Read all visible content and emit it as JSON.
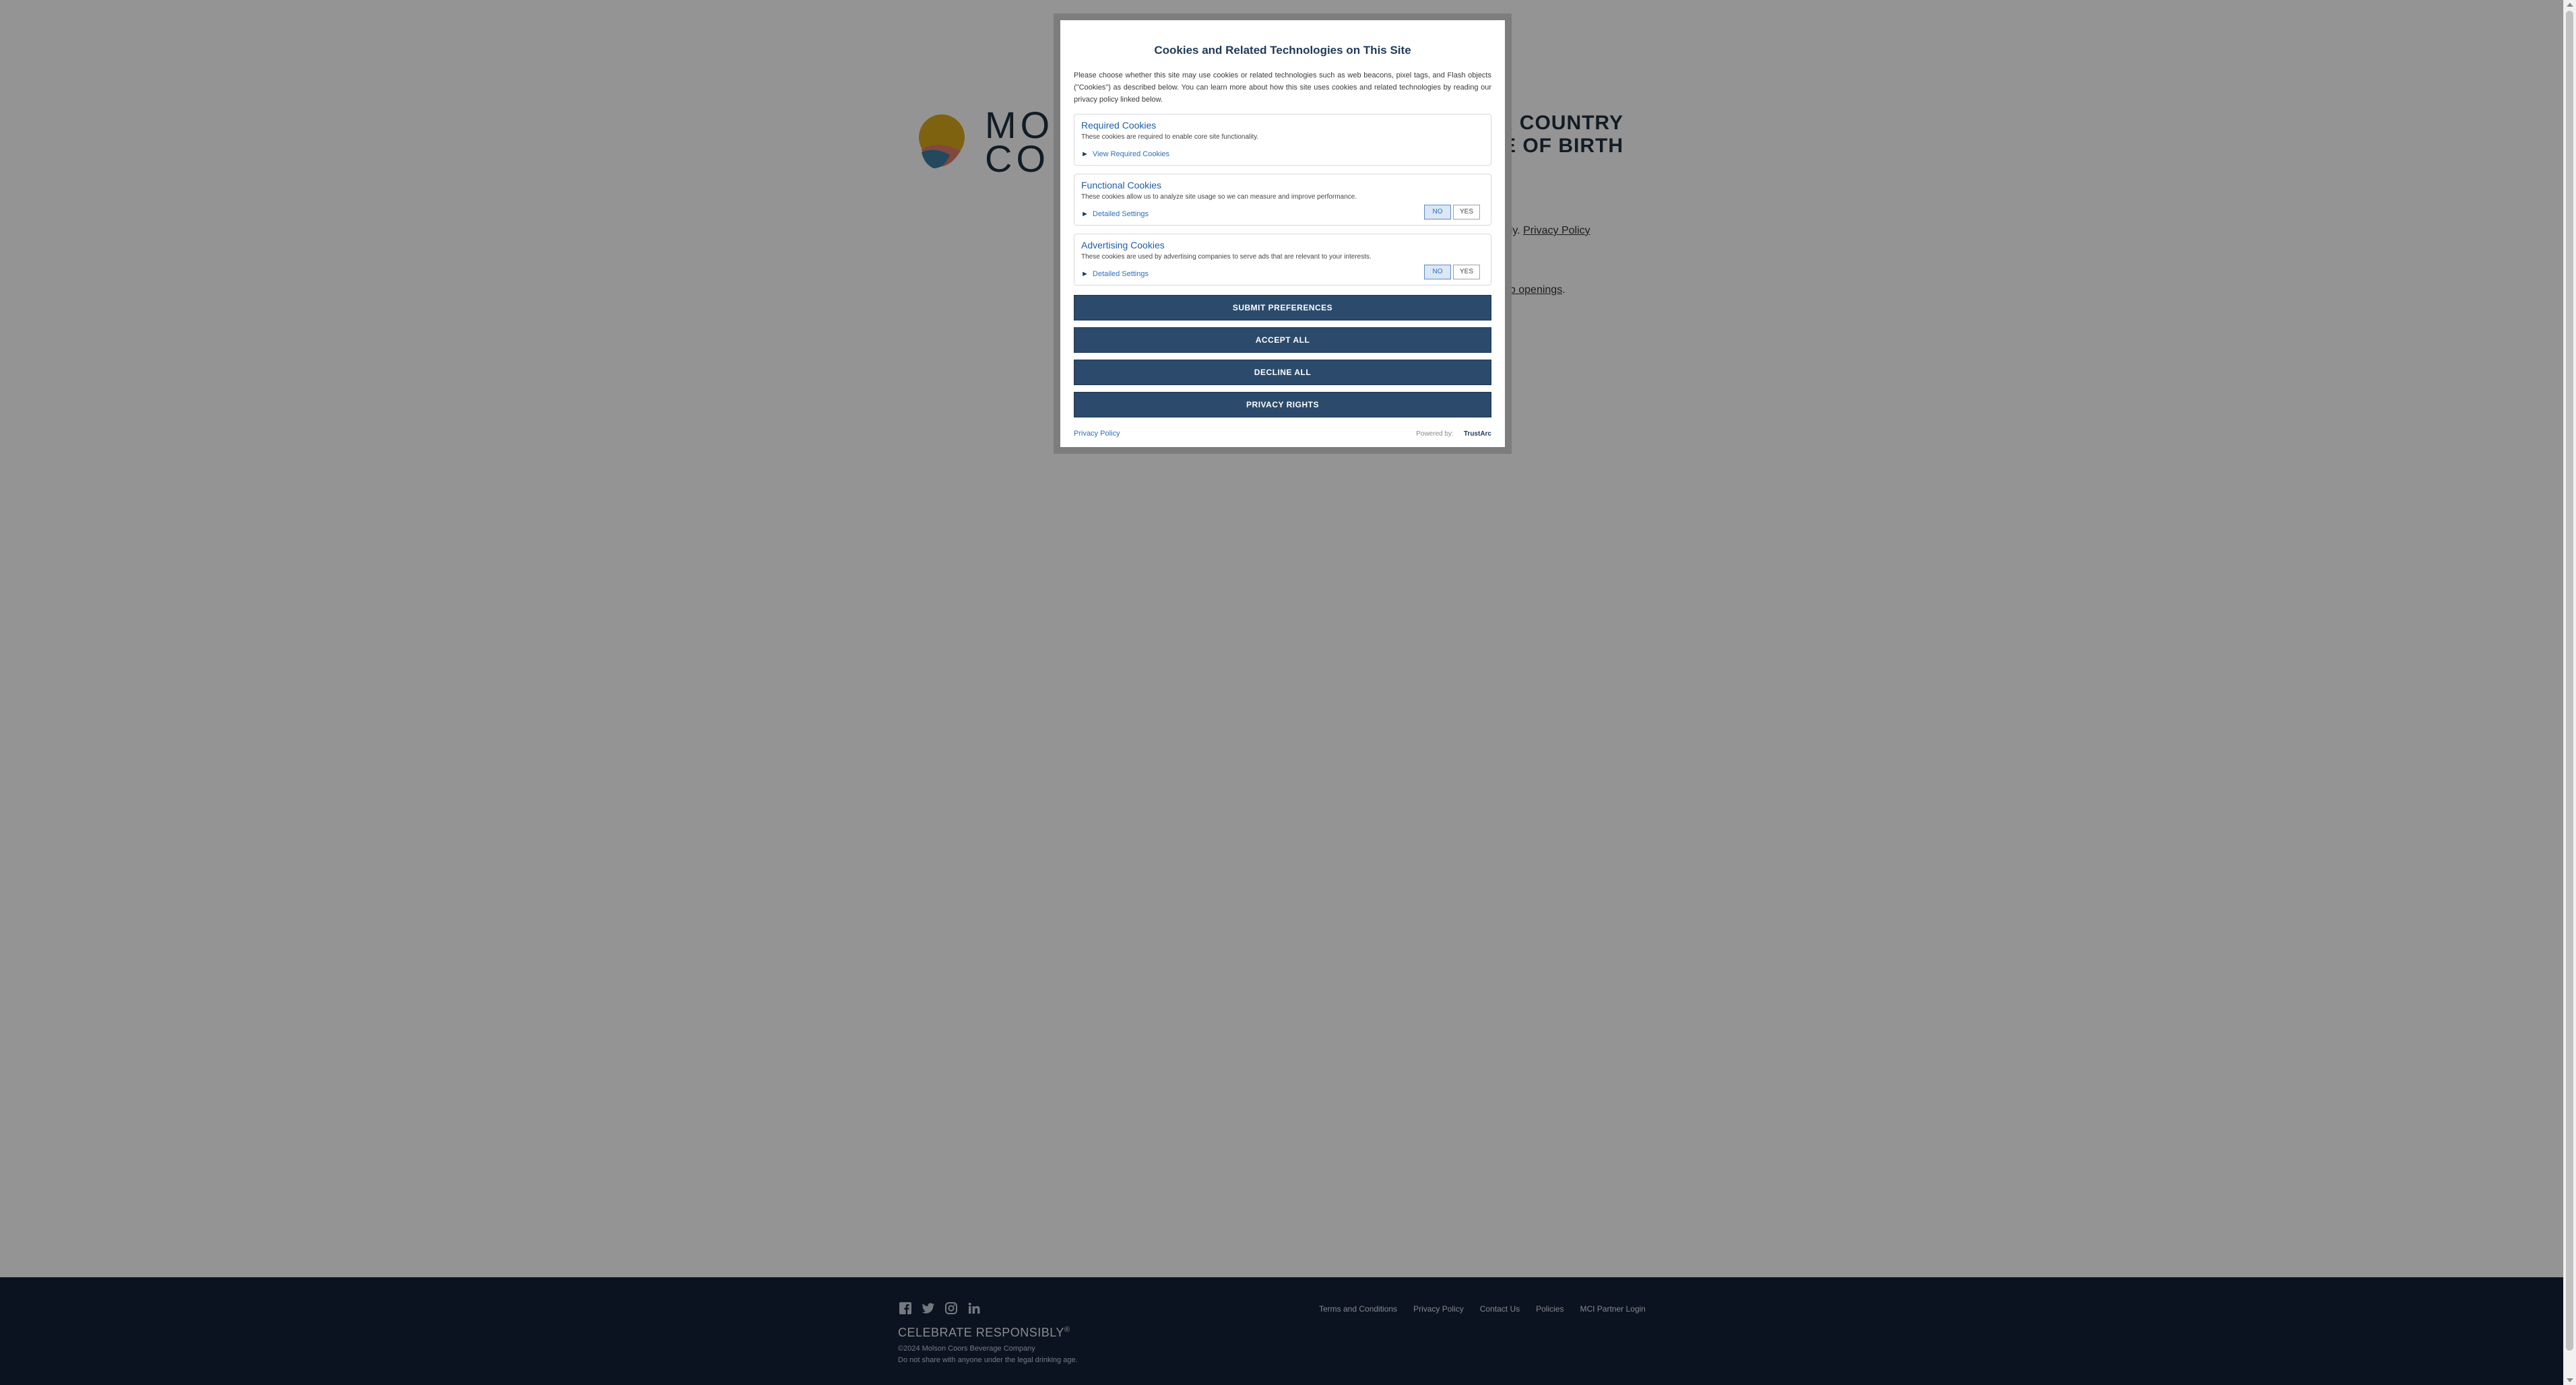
{
  "page": {
    "logo": {
      "line1": "MO",
      "line2": "CO"
    },
    "gate_title_line1": "R COUNTRY",
    "gate_title_line2": "TE OF BIRTH",
    "gate_text_1_prefix": "only.",
    "privacy_policy_link": "Privacy Policy",
    "job_openings_link": "ob openings",
    "job_openings_suffix": "."
  },
  "footer": {
    "social_icons": [
      "facebook-icon",
      "twitter-icon",
      "instagram-icon",
      "linkedin-icon"
    ],
    "celebrate": "CELEBRATE RESPONSIBLY",
    "registered": "®",
    "copyright": "©2024 Molson Coors Beverage Company",
    "notice": "Do not share with anyone under the legal drinking age.",
    "links": [
      "Terms and Conditions",
      "Privacy Policy",
      "Contact Us",
      "Policies",
      "MCI Partner Login"
    ]
  },
  "modal": {
    "title": "Cookies and Related Technologies on This Site",
    "intro": "Please choose whether this site may use cookies or related technologies such as web beacons, pixel tags, and Flash objects (\"Cookies\") as described below. You can learn more about how this site uses cookies and related technologies by reading our privacy policy linked below.",
    "sections": [
      {
        "title": "Required Cookies",
        "desc": "These cookies are required to enable core site functionality.",
        "toggle": "View Required Cookies"
      },
      {
        "title": "Functional Cookies",
        "desc": "These cookies allow us to analyze site usage so we can measure and improve performance.",
        "toggle": "Detailed Settings",
        "no": "NO",
        "yes": "YES"
      },
      {
        "title": "Advertising Cookies",
        "desc": "These cookies are used by advertising companies to serve ads that are relevant to your interests.",
        "toggle": "Detailed Settings",
        "no": "NO",
        "yes": "YES"
      }
    ],
    "buttons": {
      "submit": "SUBMIT PREFERENCES",
      "accept": "ACCEPT ALL",
      "decline": "DECLINE ALL",
      "privacy_rights": "PRIVACY RIGHTS"
    },
    "footer": {
      "privacy_policy": "Privacy Policy",
      "powered_by": "Powered by:",
      "trustarc": "TrustArc"
    }
  },
  "colors": {
    "overlay": "#000000",
    "modal_button": "#2c4b6c",
    "footer_bg": "#132139",
    "link": "#2e6fb8"
  }
}
